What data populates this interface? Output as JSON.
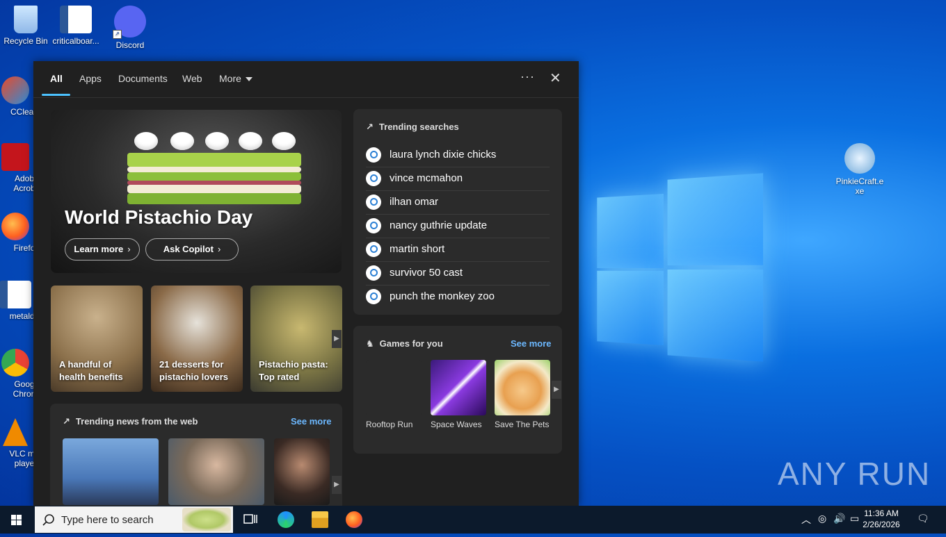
{
  "desktop": {
    "icons": [
      {
        "label": "Recycle Bin"
      },
      {
        "label": "criticalboar..."
      },
      {
        "label": "Discord"
      },
      {
        "label": "CClean"
      },
      {
        "label": "Adob\nAcrob"
      },
      {
        "label": "Firefo"
      },
      {
        "label": "metalde"
      },
      {
        "label": "Goog\nChron"
      },
      {
        "label": "VLC me\nplaye"
      },
      {
        "label": "PinkieCraft.e\nxe"
      }
    ],
    "watermark": "ANY RUN"
  },
  "search_panel": {
    "tabs": [
      {
        "label": "All"
      },
      {
        "label": "Apps"
      },
      {
        "label": "Documents"
      },
      {
        "label": "Web"
      },
      {
        "label": "More"
      }
    ],
    "more_options_label": "···",
    "close_label": "✕",
    "hero": {
      "title": "World Pistachio Day",
      "learn_more": "Learn more",
      "ask_copilot": "Ask Copilot"
    },
    "cards": [
      {
        "caption": "A handful of\nhealth benefits"
      },
      {
        "caption": "21 desserts for\npistachio lovers"
      },
      {
        "caption": "Pistachio pasta:\nTop rated"
      }
    ],
    "trending_searches": {
      "title": "Trending searches",
      "items": [
        "laura lynch dixie chicks",
        "vince mcmahon",
        "ilhan omar",
        "nancy guthrie update",
        "martin short",
        "survivor 50 cast",
        "punch the monkey zoo"
      ]
    },
    "games": {
      "title": "Games for you",
      "see_more": "See more",
      "items": [
        {
          "name": "Rooftop Run"
        },
        {
          "name": "Space Waves"
        },
        {
          "name": "Save The Pets"
        }
      ]
    },
    "news": {
      "title": "Trending news from the web",
      "see_more": "See more"
    }
  },
  "taskbar": {
    "search_placeholder": "Type here to search",
    "time": "11:36 AM",
    "date": "2/26/2026"
  },
  "colors": {
    "accent": "#4cc2ff",
    "panel_bg": "#202020",
    "card_bg": "#2b2b2b",
    "link": "#6cb8ff"
  }
}
